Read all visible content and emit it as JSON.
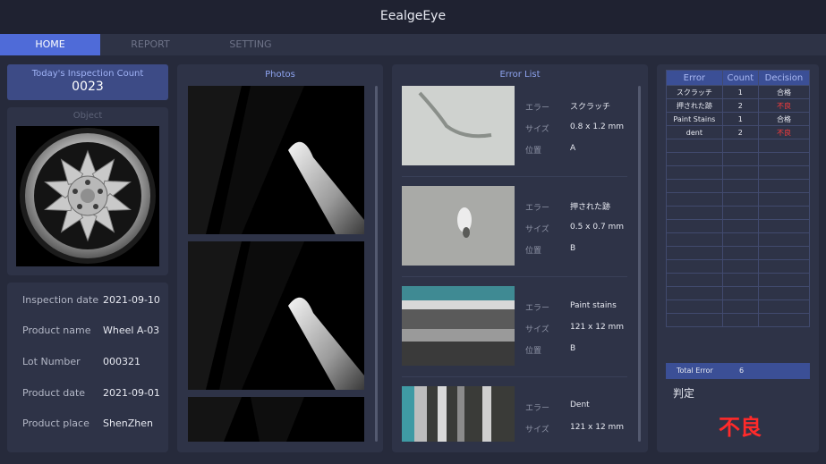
{
  "app": {
    "title": "EealgeEye"
  },
  "nav": {
    "tabs": [
      "HOME",
      "REPORT",
      "SETTING"
    ],
    "active": 0
  },
  "inspection": {
    "count_title": "Today's Inspection Count",
    "count_value": "0023"
  },
  "object": {
    "title": "Object"
  },
  "info": [
    {
      "label": "Inspection date",
      "value": "2021-09-10"
    },
    {
      "label": "Product name",
      "value": "Wheel A-03"
    },
    {
      "label": "Lot Number",
      "value": "000321"
    },
    {
      "label": "Product date",
      "value": "2021-09-01"
    },
    {
      "label": "Product place",
      "value": "ShenZhen"
    }
  ],
  "photos": {
    "title": "Photos"
  },
  "error_list": {
    "title": "Error List",
    "labels": {
      "error": "エラー",
      "size": "サイズ",
      "position": "位置"
    },
    "items": [
      {
        "error": "スクラッチ",
        "size": "0.8 x 1.2 mm",
        "position": "A"
      },
      {
        "error": "押された跡",
        "size": "0.5 x 0.7 mm",
        "position": "B"
      },
      {
        "error": "Paint stains",
        "size": "121 x 12 mm",
        "position": "B"
      },
      {
        "error": "Dent",
        "size": "121 x 12 mm",
        "position": ""
      }
    ]
  },
  "summary": {
    "headers": {
      "error": "Error",
      "count": "Count",
      "decision": "Decision"
    },
    "rows": [
      {
        "error": "スクラッチ",
        "count": "1",
        "decision": "合格",
        "ng": false
      },
      {
        "error": "押された跡",
        "count": "2",
        "decision": "不良",
        "ng": true
      },
      {
        "error": "Paint Stains",
        "count": "1",
        "decision": "合格",
        "ng": false
      },
      {
        "error": "dent",
        "count": "2",
        "decision": "不良",
        "ng": true
      }
    ],
    "total_label": "Total Error",
    "total_value": "6",
    "verdict_label": "判定",
    "verdict": "不良"
  },
  "colors": {
    "accent": "#4f6bd8",
    "ng": "#ff2a2a",
    "header": "#3b4f96"
  }
}
